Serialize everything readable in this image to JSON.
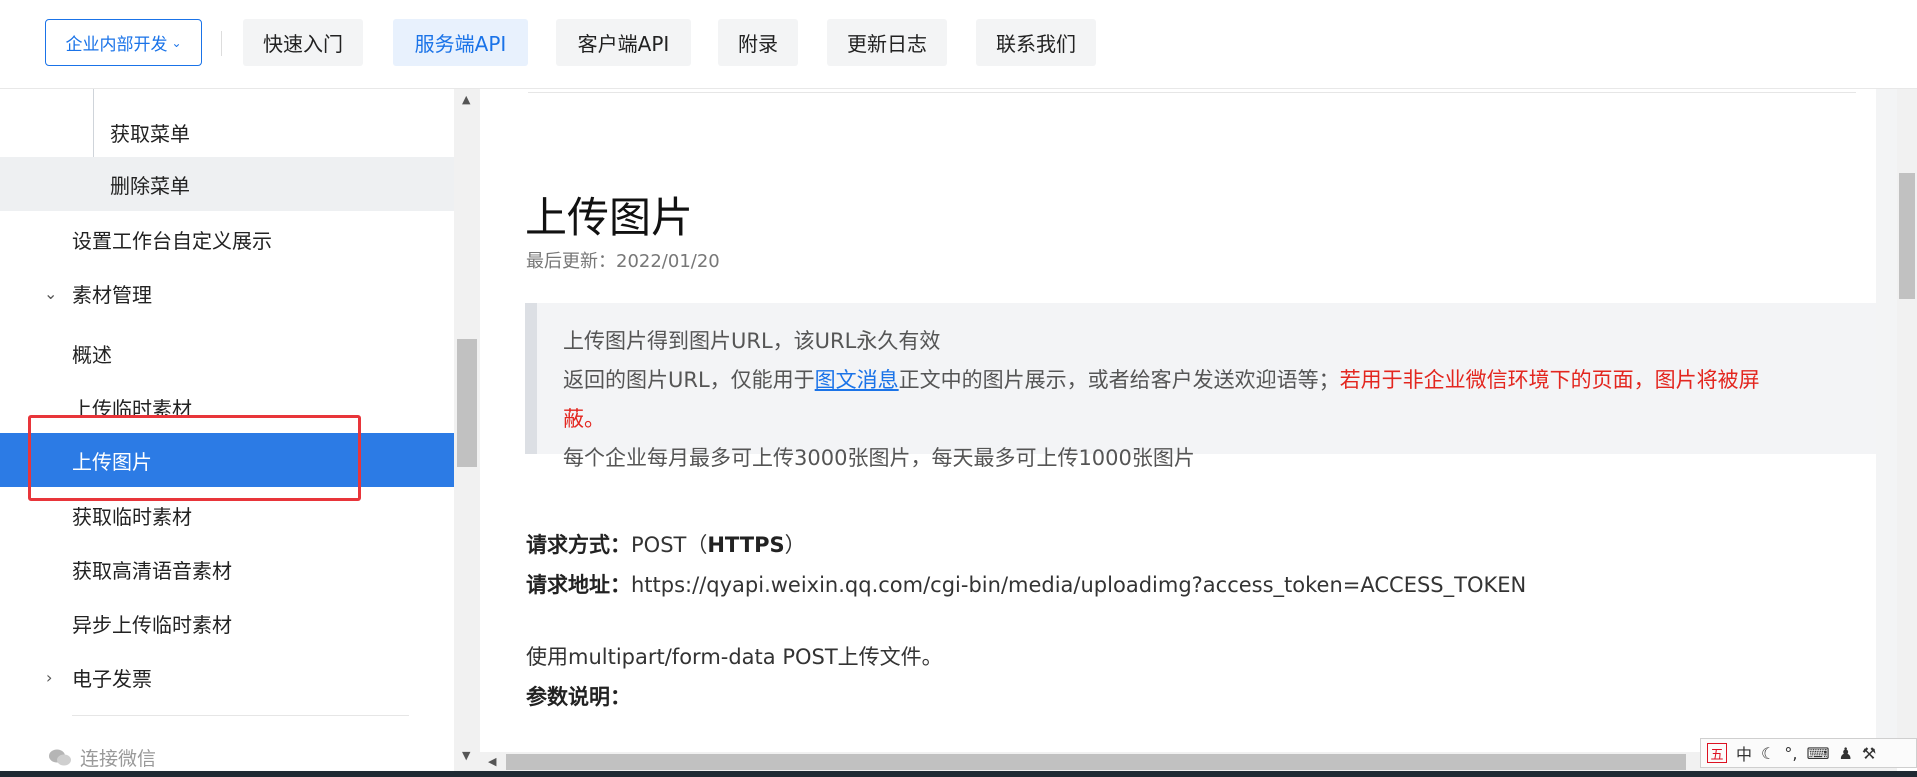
{
  "header": {
    "product_select": "企业内部开发",
    "tabs": [
      {
        "label": "快速入门"
      },
      {
        "label": "服务端API"
      },
      {
        "label": "客户端API"
      },
      {
        "label": "附录"
      },
      {
        "label": "更新日志"
      },
      {
        "label": "联系我们"
      }
    ]
  },
  "sidebar": {
    "items": [
      {
        "label": "获取菜单"
      },
      {
        "label": "删除菜单"
      },
      {
        "label": "设置工作台自定义展示"
      },
      {
        "label": "素材管理"
      },
      {
        "label": "概述"
      },
      {
        "label": "上传临时素材"
      },
      {
        "label": "上传图片"
      },
      {
        "label": "获取临时素材"
      },
      {
        "label": "获取高清语音素材"
      },
      {
        "label": "异步上传临时素材"
      },
      {
        "label": "电子发票"
      }
    ],
    "footer": "连接微信"
  },
  "article": {
    "title": "上传图片",
    "updated": "最后更新：2022/01/20",
    "note": {
      "line1": "上传图片得到图片URL，该URL永久有效",
      "line2_pre": "返回的图片URL，仅能用于",
      "line2_link": "图文消息",
      "line2_mid": "正文中的图片展示，或者给客户发送欢迎语等；",
      "line2_red": "若用于非企业微信环境下的页面，图片将被屏",
      "line2_red_cont": "蔽。",
      "line3": "每个企业每月最多可上传3000张图片，每天最多可上传1000张图片"
    },
    "request_method_label": "请求方式：",
    "request_method_value": "POST（",
    "request_method_https": "HTTPS",
    "request_method_close": "）",
    "request_url_label": "请求地址：",
    "request_url_value": "https://qyapi.weixin.qq.com/cgi-bin/media/uploadimg?access_token=ACCESS_TOKEN",
    "upload_note": "使用multipart/form-data POST上传文件。",
    "params_label": "参数说明："
  },
  "ime": {
    "badge": "五",
    "lang": "中"
  },
  "colors": {
    "accent": "#1a73e8",
    "selected_bg": "#2c7be5",
    "warning_red": "#e3261f",
    "highlight_box": "#e8353a"
  }
}
